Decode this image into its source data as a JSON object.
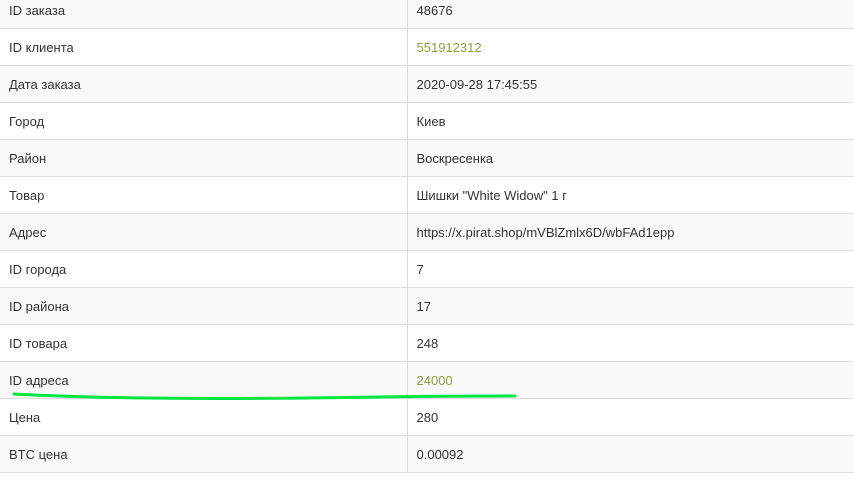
{
  "order_details": {
    "rows": [
      {
        "label": "ID заказа",
        "value": "48676",
        "link": false
      },
      {
        "label": "ID клиента",
        "value": "551912312",
        "link": true
      },
      {
        "label": "Дата заказа",
        "value": "2020-09-28 17:45:55",
        "link": false
      },
      {
        "label": "Город",
        "value": "Киев",
        "link": false
      },
      {
        "label": "Район",
        "value": "Воскресенка",
        "link": false
      },
      {
        "label": "Товар",
        "value": "Шишки \"White Widow\" 1 г",
        "link": false
      },
      {
        "label": "Адрес",
        "value": "https://x.pirat.shop/mVBlZmlx6D/wbFAd1epp",
        "link": false
      },
      {
        "label": "ID города",
        "value": "7",
        "link": false
      },
      {
        "label": "ID района",
        "value": "17",
        "link": false
      },
      {
        "label": "ID товара",
        "value": "248",
        "link": false
      },
      {
        "label": "ID адреса",
        "value": "24000",
        "link": true
      },
      {
        "label": "Цена",
        "value": "280",
        "link": false
      },
      {
        "label": "BTC цена",
        "value": "0.00092",
        "link": false
      }
    ]
  },
  "colors": {
    "link": "#8aa03a",
    "highlight_stroke": "#00e640",
    "row_stripe": "#f9f9f9",
    "border": "#dddddd"
  }
}
